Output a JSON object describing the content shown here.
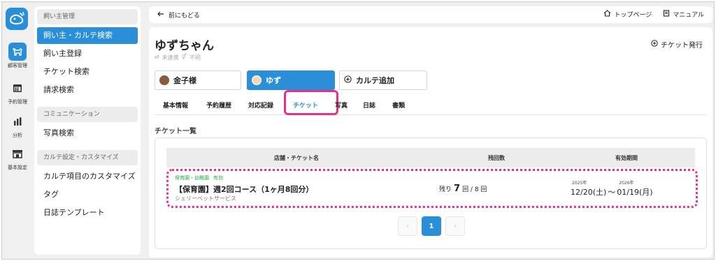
{
  "colors": {
    "accent": "#2a8fd8",
    "highlight": "#e8328a",
    "valid_badge": "#2aa64a"
  },
  "rail": {
    "items": [
      {
        "label": "顧客管理",
        "icon": "dog-icon",
        "active": true
      },
      {
        "label": "予約管理",
        "icon": "calendar-icon",
        "active": false
      },
      {
        "label": "分析",
        "icon": "bar-chart-icon",
        "active": false
      },
      {
        "label": "基本設定",
        "icon": "store-icon",
        "active": false
      }
    ]
  },
  "sidebar": {
    "section1": "飼い主管理",
    "items1": [
      "飼い主・カルテ検索",
      "飼い主登録",
      "チケット検索",
      "請求検索"
    ],
    "section2": "コミュニケーション",
    "items2": [
      "写真検索"
    ],
    "section3": "カルテ設定・カスタマイズ",
    "items3": [
      "カルテ項目のカスタマイズ",
      "タグ",
      "日誌テンプレート"
    ]
  },
  "topbar": {
    "back": "前にもどる",
    "top_page": "トップページ",
    "manual": "マニュアル"
  },
  "main": {
    "title": "ゆずちゃん",
    "link_status": "未連携",
    "gender": "不明",
    "issue_ticket": "チケット発行",
    "chips": {
      "owner": "金子様",
      "pet": "ゆず",
      "add": "カルテ追加"
    },
    "tabs": [
      "基本情報",
      "予約履歴",
      "対応記録",
      "チケット",
      "写真",
      "日誌",
      "書類"
    ],
    "section_title": "チケット一覧",
    "table": {
      "headers": [
        "店舗・チケット名",
        "残回数",
        "有効期間"
      ],
      "rows": [
        {
          "category": "保育園・幼稚園",
          "status": "有効",
          "name": "【保育園】週2回コース（1ヶ月8回分）",
          "store": "シェリーペットサービス",
          "remain_prefix": "残り",
          "remain_count": "7",
          "remain_suffix": "回 / 8 回",
          "start_year": "2025年",
          "end_year": "2026年",
          "start_date": "12/20(土)",
          "separator": "〜",
          "end_date": "01/19(月)"
        }
      ]
    },
    "pagination": {
      "prev": "‹",
      "current": "1",
      "next": "›"
    }
  }
}
